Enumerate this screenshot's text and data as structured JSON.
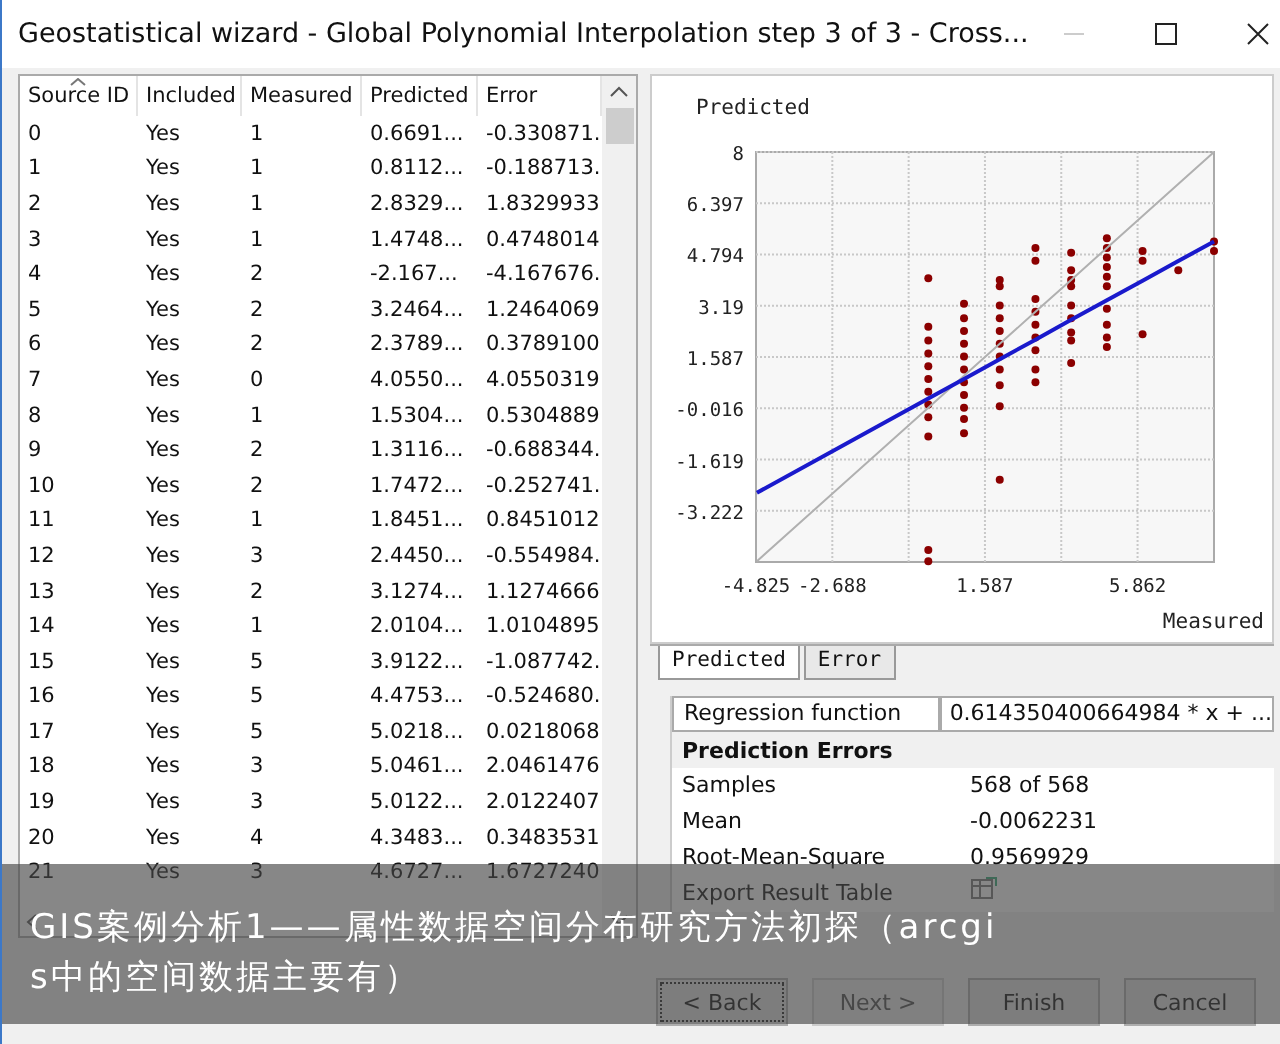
{
  "window": {
    "title": "Geostatistical wizard - Global Polynomial Interpolation step 3 of 3 - Cross..."
  },
  "table": {
    "columns": [
      "Source ID",
      "Included",
      "Measured",
      "Predicted",
      "Error"
    ],
    "rows": [
      [
        "0",
        "Yes",
        "1",
        "0.6691...",
        "-0.330871."
      ],
      [
        "1",
        "Yes",
        "1",
        "0.8112...",
        "-0.188713."
      ],
      [
        "2",
        "Yes",
        "1",
        "2.8329...",
        "1.8329933"
      ],
      [
        "3",
        "Yes",
        "1",
        "1.4748...",
        "0.4748014"
      ],
      [
        "4",
        "Yes",
        "2",
        "-2.167...",
        "-4.167676."
      ],
      [
        "5",
        "Yes",
        "2",
        "3.2464...",
        "1.2464069"
      ],
      [
        "6",
        "Yes",
        "2",
        "2.3789...",
        "0.3789100"
      ],
      [
        "7",
        "Yes",
        "0",
        "4.0550...",
        "4.0550319"
      ],
      [
        "8",
        "Yes",
        "1",
        "1.5304...",
        "0.5304889"
      ],
      [
        "9",
        "Yes",
        "2",
        "1.3116...",
        "-0.688344."
      ],
      [
        "10",
        "Yes",
        "2",
        "1.7472...",
        "-0.252741."
      ],
      [
        "11",
        "Yes",
        "1",
        "1.8451...",
        "0.8451012"
      ],
      [
        "12",
        "Yes",
        "3",
        "2.4450...",
        "-0.554984."
      ],
      [
        "13",
        "Yes",
        "2",
        "3.1274...",
        "1.1274666"
      ],
      [
        "14",
        "Yes",
        "1",
        "2.0104...",
        "1.0104895"
      ],
      [
        "15",
        "Yes",
        "5",
        "3.9122...",
        "-1.087742."
      ],
      [
        "16",
        "Yes",
        "5",
        "4.4753...",
        "-0.524680."
      ],
      [
        "17",
        "Yes",
        "5",
        "5.0218...",
        "0.0218068"
      ],
      [
        "18",
        "Yes",
        "3",
        "5.0461...",
        "2.0461476"
      ],
      [
        "19",
        "Yes",
        "3",
        "5.0122...",
        "2.0122407"
      ],
      [
        "20",
        "Yes",
        "4",
        "4.3483...",
        "0.3483531"
      ],
      [
        "21",
        "Yes",
        "3",
        "4.6727...",
        "1.6727240"
      ]
    ]
  },
  "chart": {
    "chart_data": {
      "type": "scatter",
      "ylabel": "Predicted",
      "xlabel": "Measured",
      "xlim": [
        -4.825,
        8
      ],
      "ylim": [
        -4.825,
        8
      ],
      "xticks": [
        -4.825,
        -2.688,
        1.587,
        5.862
      ],
      "yticks": [
        8,
        6.397,
        4.794,
        3.19,
        1.587,
        -0.016,
        -1.619,
        -3.222
      ],
      "x": [
        -4.8,
        0,
        0,
        0,
        0,
        0,
        0,
        0,
        0,
        0,
        0,
        0,
        0,
        1,
        1,
        1,
        1,
        1,
        1,
        1,
        1,
        1,
        1,
        1,
        2,
        2,
        2,
        2,
        2,
        2,
        2,
        2,
        2,
        2,
        2,
        3,
        3,
        3,
        3,
        3,
        3,
        3,
        3,
        3,
        4,
        4,
        4,
        4,
        4,
        4,
        4,
        4,
        4,
        5,
        5,
        5,
        5,
        5,
        5,
        5,
        5,
        5,
        5,
        6,
        6,
        6,
        7,
        8,
        8
      ],
      "grid": true,
      "series": [
        {
          "color": "#8b0000",
          "values": [
            null,
            4.05,
            2.53,
            2.1,
            1.7,
            1.3,
            0.9,
            0.5,
            0.1,
            -0.3,
            -0.9,
            -4.45,
            -4.8,
            3.25,
            2.8,
            2.4,
            2.0,
            1.6,
            1.2,
            0.8,
            0.4,
            0.0,
            -0.35,
            -0.8,
            4.0,
            3.8,
            3.2,
            2.8,
            2.4,
            2.0,
            1.6,
            1.2,
            0.7,
            0.05,
            -2.25,
            5.0,
            4.6,
            3.4,
            3.0,
            2.6,
            2.2,
            1.8,
            1.2,
            0.8,
            4.85,
            4.3,
            4.0,
            3.8,
            3.2,
            2.8,
            2.35,
            2.1,
            1.4,
            5.3,
            5.0,
            4.7,
            4.4,
            4.1,
            3.8,
            3.1,
            2.6,
            2.2,
            1.9,
            4.9,
            4.6,
            2.3,
            4.3,
            5.2,
            4.9
          ]
        },
        {
          "type": "line",
          "color": "#b0b0b0",
          "values": [
            -4.8,
            0,
            0,
            0,
            0,
            0,
            0,
            0,
            0,
            0,
            0,
            0,
            0,
            1,
            1,
            1,
            1,
            1,
            1,
            1,
            1,
            1,
            1,
            1,
            2,
            2,
            2,
            2,
            2,
            2,
            2,
            2,
            2,
            2,
            2,
            3,
            3,
            3,
            3,
            3,
            3,
            3,
            3,
            3,
            4,
            4,
            4,
            4,
            4,
            4,
            4,
            4,
            4,
            5,
            5,
            5,
            5,
            5,
            5,
            5,
            5,
            5,
            5,
            6,
            6,
            6,
            7,
            8,
            8
          ]
        },
        {
          "type": "line",
          "color": "#1a1acc",
          "values": [
            -2.66,
            0.29,
            0.29,
            0.29,
            0.29,
            0.29,
            0.29,
            0.29,
            0.29,
            0.29,
            0.29,
            0.29,
            0.29,
            0.9,
            0.9,
            0.9,
            0.9,
            0.9,
            0.9,
            0.9,
            0.9,
            0.9,
            0.9,
            0.9,
            1.52,
            1.52,
            1.52,
            1.52,
            1.52,
            1.52,
            1.52,
            1.52,
            1.52,
            1.52,
            1.52,
            2.13,
            2.13,
            2.13,
            2.13,
            2.13,
            2.13,
            2.13,
            2.13,
            2.13,
            2.75,
            2.75,
            2.75,
            2.75,
            2.75,
            2.75,
            2.75,
            2.75,
            2.75,
            3.36,
            3.36,
            3.36,
            3.36,
            3.36,
            3.36,
            3.36,
            3.36,
            3.36,
            3.36,
            3.97,
            3.97,
            3.97,
            4.59,
            5.2,
            5.2
          ]
        }
      ]
    },
    "tabs": [
      {
        "label": "Predicted",
        "selected": true
      },
      {
        "label": "Error",
        "selected": false
      }
    ]
  },
  "summary": [
    {
      "kind": "field",
      "label": "Regression function",
      "value": "0.614350400664984 * x + ..."
    },
    {
      "kind": "header",
      "label": "Prediction Errors"
    },
    {
      "kind": "value",
      "label": "Samples",
      "value": "568 of 568"
    },
    {
      "kind": "value",
      "label": "Mean",
      "value": "-0.0062231"
    },
    {
      "kind": "value",
      "label": "Root-Mean-Square",
      "value": "0.9569929"
    },
    {
      "kind": "action",
      "label": "Export Result Table"
    }
  ],
  "buttons": [
    {
      "label": "< Back",
      "disabled": false,
      "focused": true
    },
    {
      "label": "Next >",
      "disabled": true,
      "focused": false
    },
    {
      "label": "Finish",
      "disabled": false,
      "focused": false
    },
    {
      "label": "Cancel",
      "disabled": false,
      "focused": false
    }
  ],
  "caption_lines": [
    "GIS案例分析1——属性数据空间分布研究方法初探（arcgi",
    "s中的空间数据主要有）"
  ]
}
